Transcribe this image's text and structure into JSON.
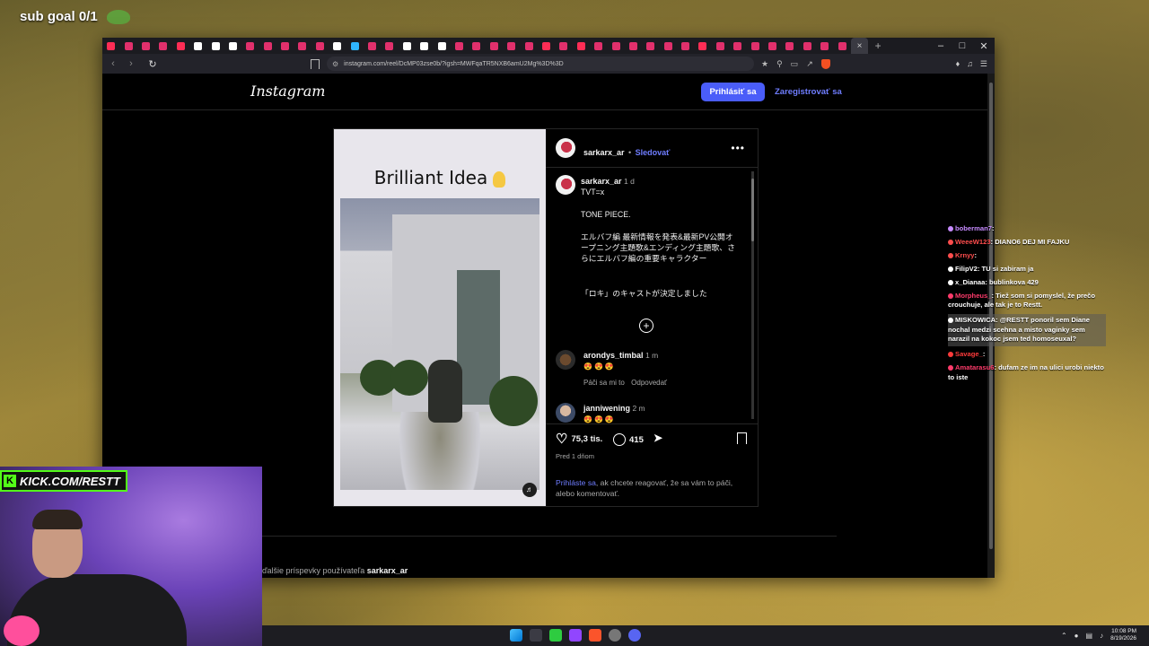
{
  "stream": {
    "sub_goal": "sub goal 0/1",
    "kick_banner": "KICK.COM/RESTT"
  },
  "browser": {
    "url": "instagram.com/reel/DcMP03zse0b/?igsh=MWFqaTR5NXB6amU2Mg%3D%3D",
    "tab_colors": [
      "#ff2d55",
      "#e1306c",
      "#e1306c",
      "#e1306c",
      "#ff2d55",
      "#ffffff",
      "#ffffff",
      "#ffffff",
      "#e1306c",
      "#e1306c",
      "#e1306c",
      "#e1306c",
      "#e1306c",
      "#ffffff",
      "#2fb5ff",
      "#e1306c",
      "#e1306c",
      "#ffffff",
      "#ffffff",
      "#ffffff",
      "#e1306c",
      "#e1306c",
      "#e1306c",
      "#e1306c",
      "#e1306c",
      "#ff2d55",
      "#e1306c",
      "#ff2d55",
      "#e1306c",
      "#e1306c",
      "#e1306c",
      "#e1306c",
      "#e1306c",
      "#e1306c",
      "#ff2d55",
      "#e1306c",
      "#e1306c",
      "#e1306c",
      "#e1306c",
      "#e1306c",
      "#e1306c",
      "#e1306c",
      "#e1306c"
    ],
    "new_tab": "+",
    "close_tab": "×"
  },
  "instagram": {
    "logo": "Instagram",
    "login_button": "Prihlásiť sa",
    "signup_link": "Zaregistrovať sa",
    "post": {
      "media_title": "Brilliant Idea",
      "author": "sarkarx_ar",
      "separator": "•",
      "follow": "Sledovať",
      "caption": {
        "username": "sarkarx_ar",
        "time": "1 d",
        "line1": "TVT=x",
        "line2": "TONE PIECE.",
        "line3": "エルバフ編 最新情報を発表&最新PV公開オープニング主題歌&エンディング主題歌、さらにエルバフ編の重要キャラクター",
        "line4": "「ロキ」のキャストが決定しました"
      },
      "comments": [
        {
          "username": "arondys_timbal",
          "time": "1 m",
          "emojis": "😍😍😍",
          "likes_label": "Páči sa mi to",
          "reply_label": "Odpovedať"
        },
        {
          "username": "janniwening",
          "time": "2 m",
          "emojis": "😍😍😍"
        }
      ],
      "likes": "75,3 tis.",
      "comment_count": "415",
      "posted": "Pred 1 dňom",
      "login_prompt_link": "Prihláste sa",
      "login_prompt_text": ", ak chcete reagovať, že sa vám to páči, alebo komentovať."
    },
    "more_posts_prefix": "ďalšie príspevky používateľa",
    "more_posts_user": "sarkarx_ar"
  },
  "chat": [
    {
      "user": "boberman7",
      "text": "",
      "color": "#c78bff",
      "highlight": false
    },
    {
      "user": "WeeeW123",
      "text": "DIANO6 DEJ MI FAJKU",
      "color": "#ff4d4d",
      "highlight": false
    },
    {
      "user": "Krnyy",
      "text": "",
      "color": "#ff4d4d",
      "highlight": false
    },
    {
      "user": "FilipV2",
      "text": "TU si zabiram ja",
      "color": "#ffffff",
      "highlight": false
    },
    {
      "user": "x_Dianaa",
      "text": "bublinkova 429",
      "color": "#ffffff",
      "highlight": false
    },
    {
      "user": "Morpheus_",
      "text": "Tiež som si pomyslel, že prečo crouchuje, ale tak je to Restt.",
      "color": "#ff3b6b",
      "highlight": false
    },
    {
      "user": "MISKOWICA",
      "text": "@RESTT ponoril sem Diane nochal medzi scehna a misto vaginky sem narazil na kokoc jsem ted homoseuxal?",
      "color": "#ffffff",
      "highlight": true
    },
    {
      "user": "Savage_",
      "text": "",
      "color": "#ff3b3b",
      "highlight": false
    },
    {
      "user": "Amatarasu6",
      "text": "dufam ze im na ulici urobi niekto to iste",
      "color": "#ff3b6b",
      "highlight": false
    }
  ],
  "taskbar": {
    "time": "10:08 PM",
    "date": "8/19/2026"
  }
}
